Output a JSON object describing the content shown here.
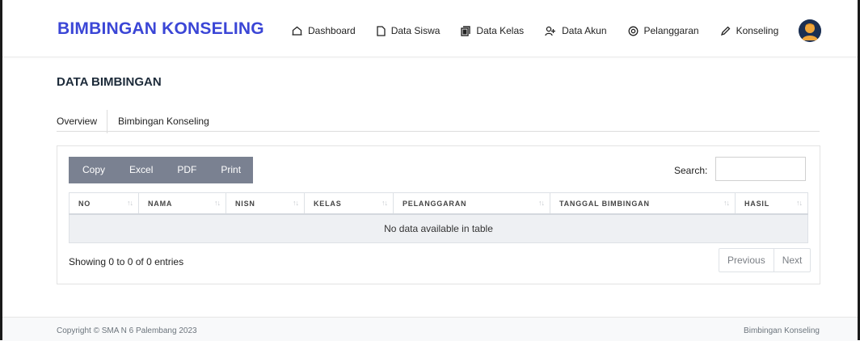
{
  "navbar": {
    "brand": "BIMBINGAN KONSELING",
    "items": [
      {
        "label": "Dashboard",
        "icon": "home-outline-icon"
      },
      {
        "label": "Data Siswa",
        "icon": "file-icon"
      },
      {
        "label": "Data Kelas",
        "icon": "copy-icon"
      },
      {
        "label": "Data Akun",
        "icon": "user-add-icon"
      },
      {
        "label": "Pelanggaran",
        "icon": "settings-circle-icon"
      },
      {
        "label": "Konseling",
        "icon": "pencil-icon"
      }
    ]
  },
  "page": {
    "title": "DATA BIMBINGAN",
    "tabs": [
      "Overview",
      "Bimbingan Konseling"
    ]
  },
  "table": {
    "buttons": [
      "Copy",
      "Excel",
      "PDF",
      "Print"
    ],
    "search_label": "Search:",
    "search_value": "",
    "columns": [
      "NO",
      "NAMA",
      "NISN",
      "KELAS",
      "PELANGGARAN",
      "TANGGAL BIMBINGAN",
      "HASIL"
    ],
    "empty_message": "No data available in table",
    "info": "Showing 0 to 0 of 0 entries",
    "pagination": {
      "previous": "Previous",
      "next": "Next"
    }
  },
  "footer": {
    "copyright": "Copyright © SMA N 6 Palembang 2023",
    "right": "Bimbingan Konseling"
  },
  "colors": {
    "brand": "#3b46d6",
    "button_group": "#7a8191",
    "empty_row": "#eef0f3"
  }
}
